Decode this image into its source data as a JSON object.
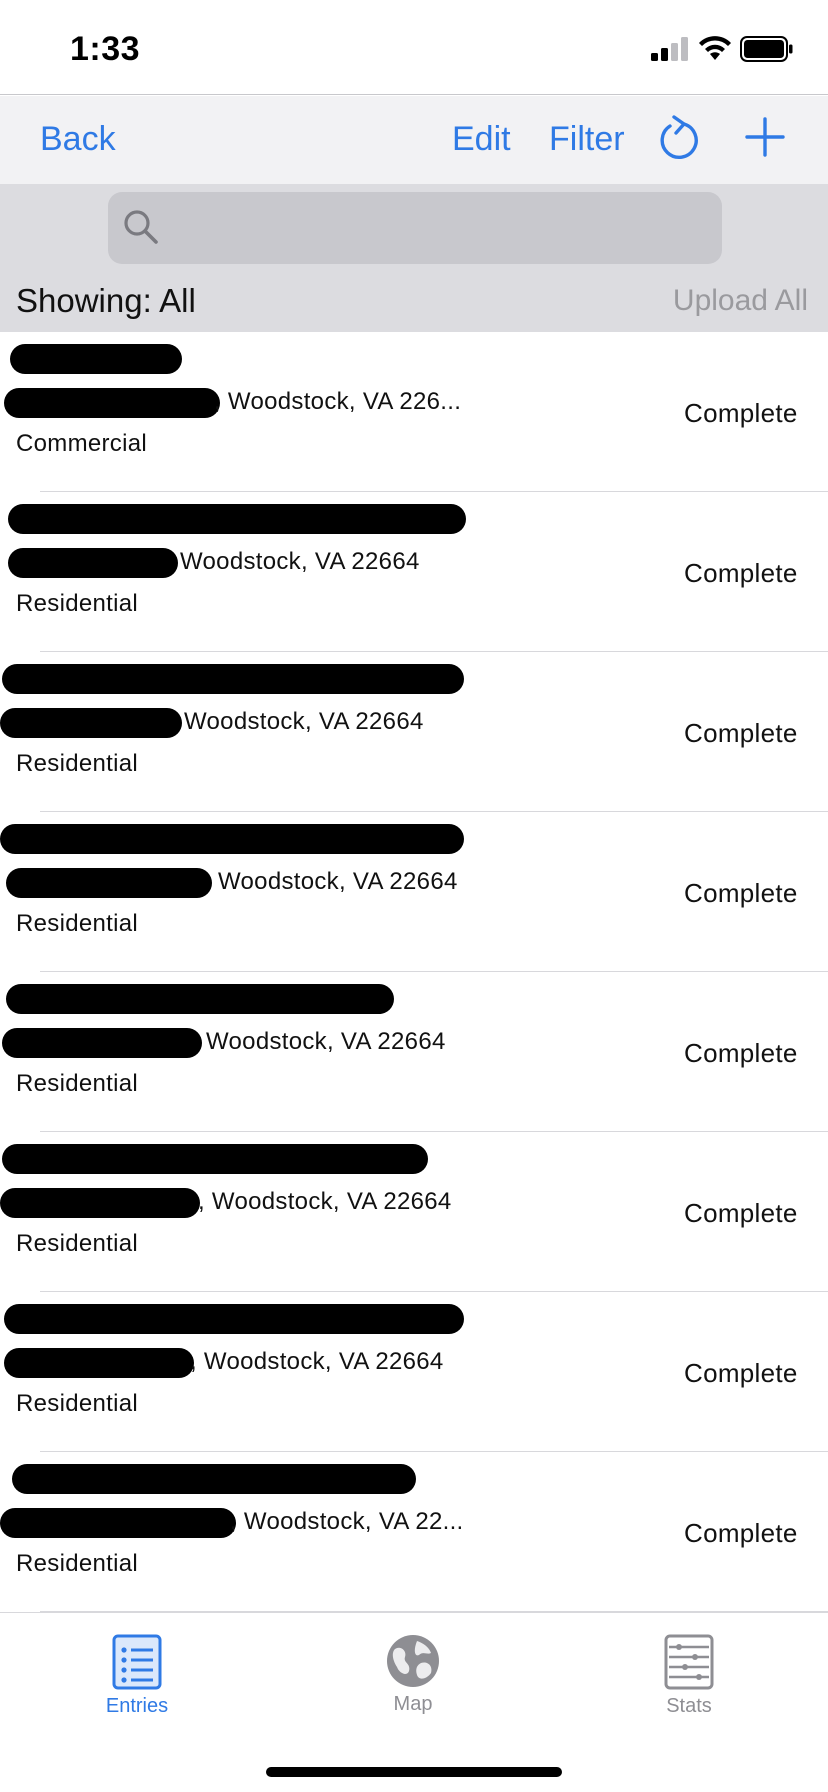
{
  "status_bar": {
    "time": "1:33"
  },
  "nav": {
    "back": "Back",
    "edit": "Edit",
    "filter": "Filter"
  },
  "search": {
    "placeholder": "",
    "value": ""
  },
  "header": {
    "showing": "Showing: All",
    "upload_all": "Upload All"
  },
  "entries": [
    {
      "city": ", Woodstock, VA 226...",
      "type": "Commercial",
      "status": "Complete"
    },
    {
      "city": "Woodstock, VA 22664",
      "type": "Residential",
      "status": "Complete"
    },
    {
      "city": "Woodstock, VA 22664",
      "type": "Residential",
      "status": "Complete"
    },
    {
      "city": "Woodstock, VA 22664",
      "type": "Residential",
      "status": "Complete"
    },
    {
      "city": "Woodstock, VA 22664",
      "type": "Residential",
      "status": "Complete"
    },
    {
      "city": ", Woodstock, VA 22664",
      "type": "Residential",
      "status": "Complete"
    },
    {
      "city": ", Woodstock, VA 22664",
      "type": "Residential",
      "status": "Complete"
    },
    {
      "city": ", Woodstock, VA 22...",
      "type": "Residential",
      "status": "Complete"
    }
  ],
  "tabs": {
    "entries": "Entries",
    "map": "Map",
    "stats": "Stats"
  },
  "colors": {
    "accent": "#2f7ae5",
    "inactive": "#8e8e93"
  }
}
